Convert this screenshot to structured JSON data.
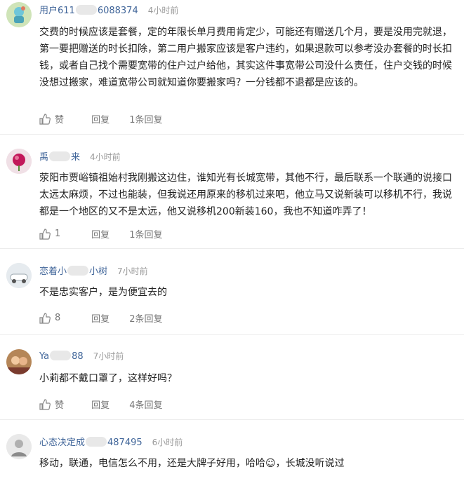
{
  "comments": [
    {
      "user_pre": "用户611",
      "user_post": "6088374",
      "time": "4小时前",
      "text": "交费的时候应该是套餐，定的年限长单月费用肯定少，可能还有赠送几个月，要是没用完就退，第一要把赠送的时长扣除，第二用户搬家应该是客户违约，如果退款可以参考没办套餐的时长扣钱，或者自己找个需要宽带的住户过户给他，其实这件事宽带公司没什么责任，住户交钱的时候没想过搬家，难道宽带公司就知道你要搬家吗？一分钱都不退都是应该的。",
      "like": "赞",
      "reply": "回复",
      "replies": "1条回复"
    },
    {
      "user_pre": "禹",
      "user_post": "来",
      "time": "4小时前",
      "text": "荥阳市贾峪镇祖始村我刚搬这边住，谁知光有长城宽带，其他不行，最后联系一个联通的说接口太远太麻烦，不过也能装，但我说还用原来的移机过来吧，他立马又说新装可以移机不行，我说都是一个地区的又不是太远，他又说移机200新装160，我也不知道咋弄了！",
      "like": "1",
      "reply": "回复",
      "replies": "1条回复"
    },
    {
      "user_pre": "恋着小",
      "user_post": "小树",
      "time": "7小时前",
      "text": "不是忠实客户，是为便宜去的",
      "like": "8",
      "reply": "回复",
      "replies": "2条回复"
    },
    {
      "user_pre": "Ya",
      "user_post": "88",
      "time": "7小时前",
      "text": "小莉都不戴口罩了，这样好吗？",
      "like": "赞",
      "reply": "回复",
      "replies": "4条回复"
    },
    {
      "user_pre": "心态决定成",
      "user_post": "487495",
      "time": "6小时前",
      "text": "移动，联通，电信怎么不用，还是大牌子好用，哈哈☺，长城没听说过",
      "like": "",
      "reply": "",
      "replies": ""
    }
  ]
}
